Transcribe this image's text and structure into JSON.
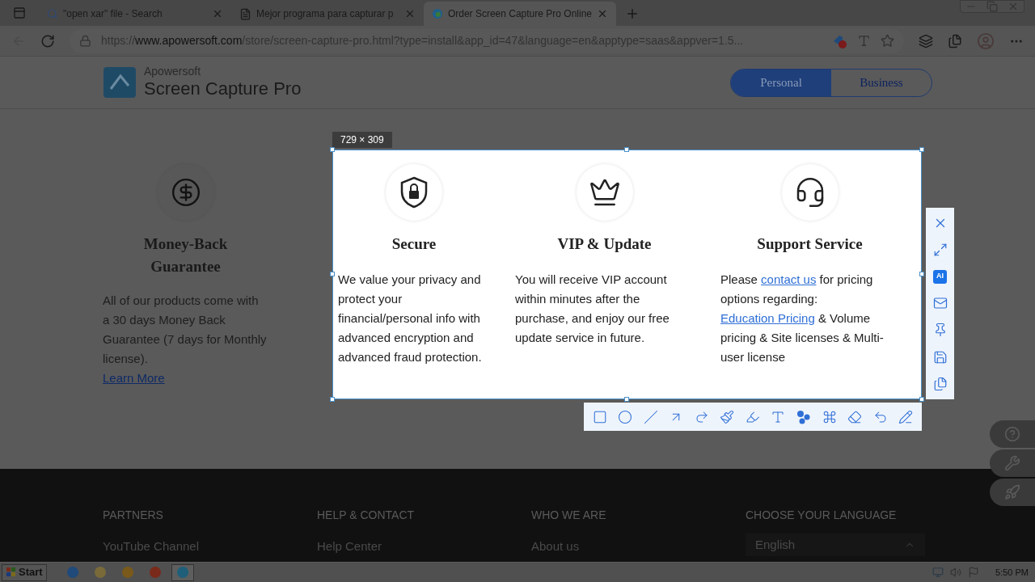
{
  "browser": {
    "tabs": [
      {
        "title": "\"open xar\" file - Search",
        "kind": "search",
        "selected": false
      },
      {
        "title": "Mejor programa para capturar p",
        "kind": "page",
        "selected": false
      },
      {
        "title": "Order Screen Capture Pro Online",
        "kind": "edge",
        "selected": true
      }
    ],
    "url": {
      "scheme": "https://",
      "host": "www.apowersoft.com",
      "path": "/store/screen-capture-pro.html?type=install&app_id=47&language=en&apptype=saas&appver=1.5..."
    }
  },
  "site": {
    "brand": "Apowersoft",
    "product": "Screen Capture Pro",
    "plans": [
      {
        "label": "Personal",
        "selected": true
      },
      {
        "label": "Business",
        "selected": false
      }
    ]
  },
  "features": [
    {
      "kind": "dollar",
      "title": "Money-Back Guarantee",
      "captured": false,
      "text": [
        {
          "kind": "text",
          "text": "All of our products come with a 30 days Money Back Guarantee (7 days for Monthly license)."
        }
      ],
      "more": "Learn More"
    },
    {
      "kind": "shield",
      "title": "Secure",
      "captured": true,
      "text": [
        {
          "kind": "text",
          "text": "We value your privacy and protect your financial/personal info with advanced encryption and advanced fraud protection."
        }
      ]
    },
    {
      "kind": "crown",
      "title": "VIP & Update",
      "captured": true,
      "text": [
        {
          "kind": "text",
          "text": "You will receive VIP account within minutes after the purchase, and enjoy our free update service in future."
        }
      ]
    },
    {
      "kind": "headset",
      "title": "Support Service",
      "captured": true,
      "text": [
        {
          "kind": "text",
          "text": "Please "
        },
        {
          "kind": "link",
          "text": "contact us"
        },
        {
          "kind": "text",
          "text": " for pricing options regarding: "
        },
        {
          "kind": "link",
          "text": "Education Pricing"
        },
        {
          "kind": "text",
          "text": " & Volume pricing & Site licenses & Multi-user license"
        }
      ]
    }
  ],
  "capture": {
    "size_label": "729 × 309",
    "ai_label": "AI",
    "side_tools": [
      {
        "kind": "close"
      },
      {
        "kind": "fullscreen"
      },
      {
        "kind": "ai"
      },
      {
        "kind": "mail"
      },
      {
        "kind": "pin"
      },
      {
        "kind": "save"
      },
      {
        "kind": "copy"
      }
    ],
    "draw_tools": [
      {
        "kind": "rectangle"
      },
      {
        "kind": "ellipse"
      },
      {
        "kind": "line"
      },
      {
        "kind": "arrow"
      },
      {
        "kind": "curved-arrow"
      },
      {
        "kind": "brush"
      },
      {
        "kind": "highlighter"
      },
      {
        "kind": "text"
      },
      {
        "kind": "number"
      },
      {
        "kind": "mosaic"
      },
      {
        "kind": "eraser"
      },
      {
        "kind": "undo"
      },
      {
        "kind": "edit"
      }
    ]
  },
  "float_buttons": [
    {
      "kind": "help"
    },
    {
      "kind": "wrench"
    },
    {
      "kind": "rocket"
    }
  ],
  "footer": {
    "columns": [
      {
        "heading": "PARTNERS",
        "items": [
          "YouTube Channel"
        ]
      },
      {
        "heading": "HELP & CONTACT",
        "items": [
          "Help Center"
        ]
      },
      {
        "heading": "WHO WE ARE",
        "items": [
          "About us"
        ]
      }
    ],
    "language": {
      "heading": "CHOOSE YOUR LANGUAGE",
      "value": "English"
    }
  },
  "taskbar": {
    "start": "Start",
    "apps": [
      {
        "kind": "ie",
        "selected": false
      },
      {
        "kind": "folder",
        "selected": false
      },
      {
        "kind": "media",
        "selected": false
      },
      {
        "kind": "chrome",
        "selected": false
      },
      {
        "kind": "edge",
        "selected": true
      }
    ],
    "time": "5:50 PM"
  }
}
